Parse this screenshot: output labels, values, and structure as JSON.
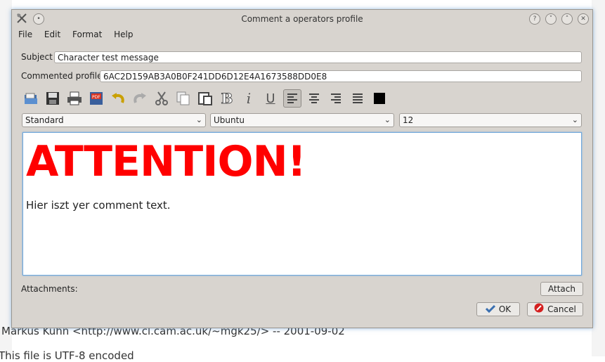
{
  "window": {
    "title": "Comment a operators profile"
  },
  "menu": [
    {
      "label": "File"
    },
    {
      "label": "Edit"
    },
    {
      "label": "Format"
    },
    {
      "label": "Help"
    }
  ],
  "form": {
    "subject_label": "Subject",
    "subject_value": "Character test message",
    "profile_label": "Commented profile",
    "profile_value": "6AC2D159AB3A0B0F241DD6D12E4A1673588DD0E8"
  },
  "format": {
    "style": "Standard",
    "font": "Ubuntu",
    "size": "12"
  },
  "editor": {
    "heading": "ATTENTION!",
    "body": "Hier iszt yer comment text.",
    "heading_color": "#ff0000"
  },
  "attachments_label": "Attachments:",
  "buttons": {
    "attach": "Attach",
    "ok": "OK",
    "cancel": "Cancel"
  },
  "toolbar_icons": [
    "open-icon",
    "save-icon",
    "print-icon",
    "export-pdf-icon",
    "undo-icon",
    "redo-icon",
    "cut-icon",
    "copy-icon",
    "paste-icon",
    "bold-icon",
    "italic-icon",
    "underline-icon",
    "align-left-icon",
    "align-center-icon",
    "align-right-icon",
    "justify-icon",
    "text-color-icon"
  ],
  "background": {
    "footer_line": "Markus Kuhn <http://www.cl.cam.ac.uk/~mgk25/> -- 2001-09-02",
    "last_line": "This file is UTF-8 encoded"
  }
}
